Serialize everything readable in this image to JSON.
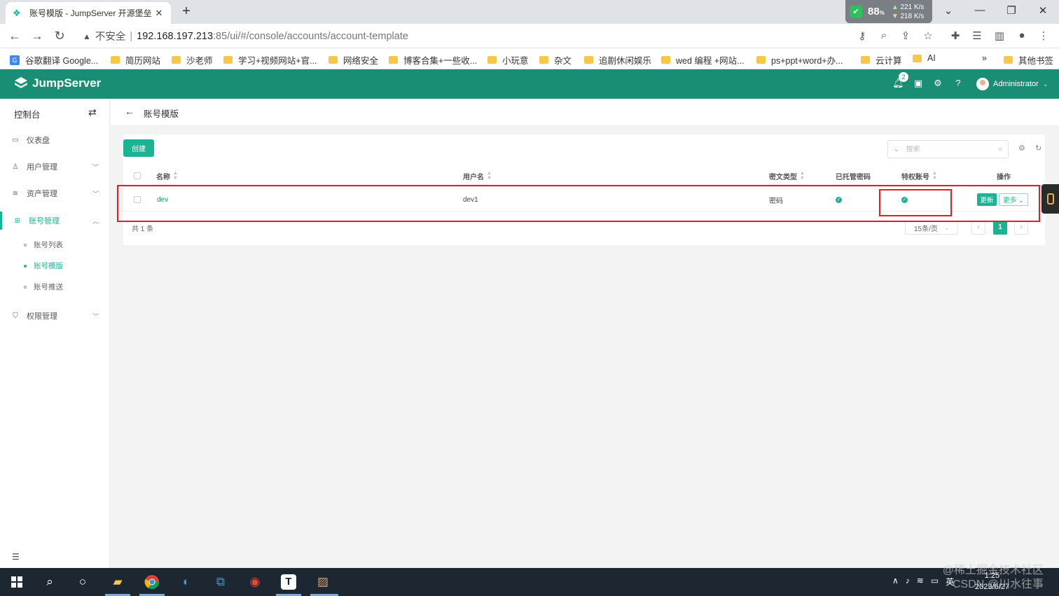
{
  "browser": {
    "tab_title": "账号模版 - JumpServer 开源堡垒",
    "net": {
      "percent": "88",
      "percent_unit": "%",
      "up": "221 K/s",
      "down": "218 K/s"
    },
    "insecure_label": "不安全",
    "url_host": "192.168.197.213",
    "url_path": ":85/ui/#/console/accounts/account-template",
    "bookmarks": [
      {
        "label": "谷歌翻译 Google...",
        "type": "translate"
      },
      {
        "label": "简历网站",
        "type": "folder"
      },
      {
        "label": "沙老师",
        "type": "folder"
      },
      {
        "label": "学习+视频网站+官...",
        "type": "folder"
      },
      {
        "label": "网络安全",
        "type": "folder"
      },
      {
        "label": "博客合集+一些收...",
        "type": "folder"
      },
      {
        "label": "小玩意",
        "type": "folder"
      },
      {
        "label": "杂文",
        "type": "folder"
      },
      {
        "label": "追剧休闲娱乐",
        "type": "folder"
      },
      {
        "label": "wed 编程 +网站...",
        "type": "folder"
      },
      {
        "label": "ps+ppt+word+办...",
        "type": "folder"
      },
      {
        "label": "云计算",
        "type": "folder"
      },
      {
        "label": "AI",
        "type": "folder"
      }
    ],
    "bookmarks_overflow": "»",
    "other_bookmarks": "其他书签"
  },
  "app": {
    "logo_text": "JumpServer",
    "notification_count": "2",
    "user_name": "Administrator",
    "accent_color": "#1a8e74"
  },
  "sidebar": {
    "title": "控制台",
    "items": [
      {
        "label": "仪表盘",
        "icon": "dashboard-icon"
      },
      {
        "label": "用户管理",
        "icon": "users-icon"
      },
      {
        "label": "资产管理",
        "icon": "assets-icon"
      },
      {
        "label": "账号管理",
        "icon": "accounts-icon"
      },
      {
        "label": "权限管理",
        "icon": "permission-icon"
      }
    ],
    "sub_items": [
      {
        "label": "账号列表"
      },
      {
        "label": "账号模版"
      },
      {
        "label": "账号推送"
      }
    ]
  },
  "page": {
    "title": "账号模版",
    "create_label": "创建",
    "search_placeholder": "搜索"
  },
  "table": {
    "headers": {
      "name": "名称",
      "username": "用户名",
      "secret_type": "密文类型",
      "hosted_password": "已托管密码",
      "privileged": "特权账号",
      "actions": "操作"
    },
    "rows": [
      {
        "name": "dev",
        "username": "dev1",
        "secret_type": "密码",
        "hosted_password": true,
        "privileged": true
      }
    ],
    "update_label": "更新",
    "more_label": "更多"
  },
  "pagination": {
    "total_text": "共 1 条",
    "page_size": "15条/页",
    "current_page": "1"
  },
  "taskbar": {
    "ime": "英",
    "time": "1:25",
    "date": "2023/6/27"
  },
  "watermark": {
    "line1": "@稀土掘金技术社区",
    "line2": "CSDN @川水往事"
  }
}
